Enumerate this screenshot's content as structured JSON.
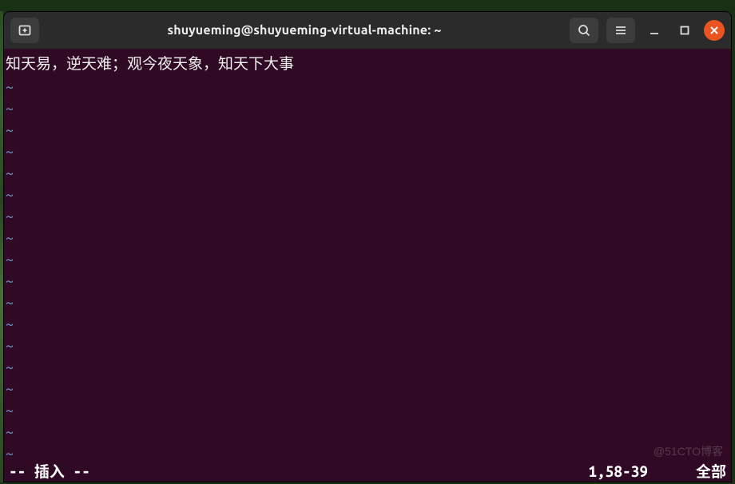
{
  "titlebar": {
    "title": "shuyueming@shuyueming-virtual-machine: ~"
  },
  "terminal": {
    "content_line": "知天易，逆天难；观今夜天象，知天下大事",
    "tilde": "~"
  },
  "status": {
    "mode": "-- 插入 --",
    "position": "1,58-39",
    "extent": "全部"
  },
  "watermark": "@51CTO博客",
  "icons": {
    "new_tab": "new-tab-icon",
    "search": "search-icon",
    "menu": "menu-icon",
    "minimize": "minimize-icon",
    "maximize": "maximize-icon",
    "close": "close-icon"
  }
}
